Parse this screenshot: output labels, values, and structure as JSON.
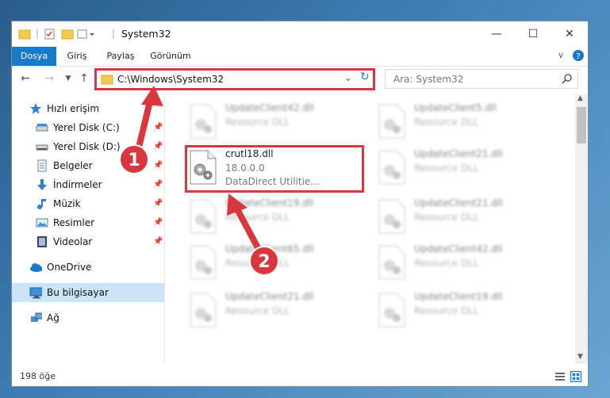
{
  "window": {
    "title": "System32"
  },
  "ribbon": {
    "tabs": [
      "Dosya",
      "Giriş",
      "Paylaş",
      "Görünüm"
    ]
  },
  "address": {
    "path": "C:\\Windows\\System32"
  },
  "search": {
    "placeholder": "Ara: System32"
  },
  "sidebar": {
    "items": [
      {
        "label": "Hızlı erişim",
        "icon": "star-icon"
      },
      {
        "label": "Yerel Disk (C:)",
        "icon": "drive-icon"
      },
      {
        "label": "Yerel Disk (D:)",
        "icon": "drive-icon"
      },
      {
        "label": "Belgeler",
        "icon": "documents-icon"
      },
      {
        "label": "İndirmeler",
        "icon": "download-icon"
      },
      {
        "label": "Müzik",
        "icon": "music-icon"
      },
      {
        "label": "Resimler",
        "icon": "pictures-icon"
      },
      {
        "label": "Videolar",
        "icon": "videos-icon"
      },
      {
        "label": "OneDrive",
        "icon": "cloud-icon"
      },
      {
        "label": "Bu bilgisayar",
        "icon": "computer-icon"
      },
      {
        "label": "Ağ",
        "icon": "network-icon"
      }
    ]
  },
  "files": [
    {
      "name": "UpdateClient42.dll",
      "line2": "Resource DLL"
    },
    {
      "name": "UpdateClient5.dll",
      "line2": "Resource DLL"
    },
    {
      "name": "crutl18.dll",
      "line2": "18.0.0.0",
      "line3": "DataDirect Utilitie..."
    },
    {
      "name": "UpdateClient21.dll",
      "line2": "Resource DLL"
    },
    {
      "name": "UpdateClient19.dll",
      "line2": "Resource DLL"
    },
    {
      "name": "UpdateClient21.dll",
      "line2": "Resource DLL"
    },
    {
      "name": "UpdateClient65.dll",
      "line2": "Resource DLL"
    },
    {
      "name": "UpdateClient42.dll",
      "line2": "Resource DLL"
    },
    {
      "name": "UpdateClient21.dll",
      "line2": "Resource DLL"
    },
    {
      "name": "UpdateClient19.dll",
      "line2": "Resource DLL"
    }
  ],
  "status": {
    "count": "198 öğe"
  },
  "annotations": {
    "marker1": "1",
    "marker2": "2"
  },
  "colors": {
    "accent": "#1979ca",
    "annotation": "#d9363e",
    "selection": "#cce4f7"
  }
}
